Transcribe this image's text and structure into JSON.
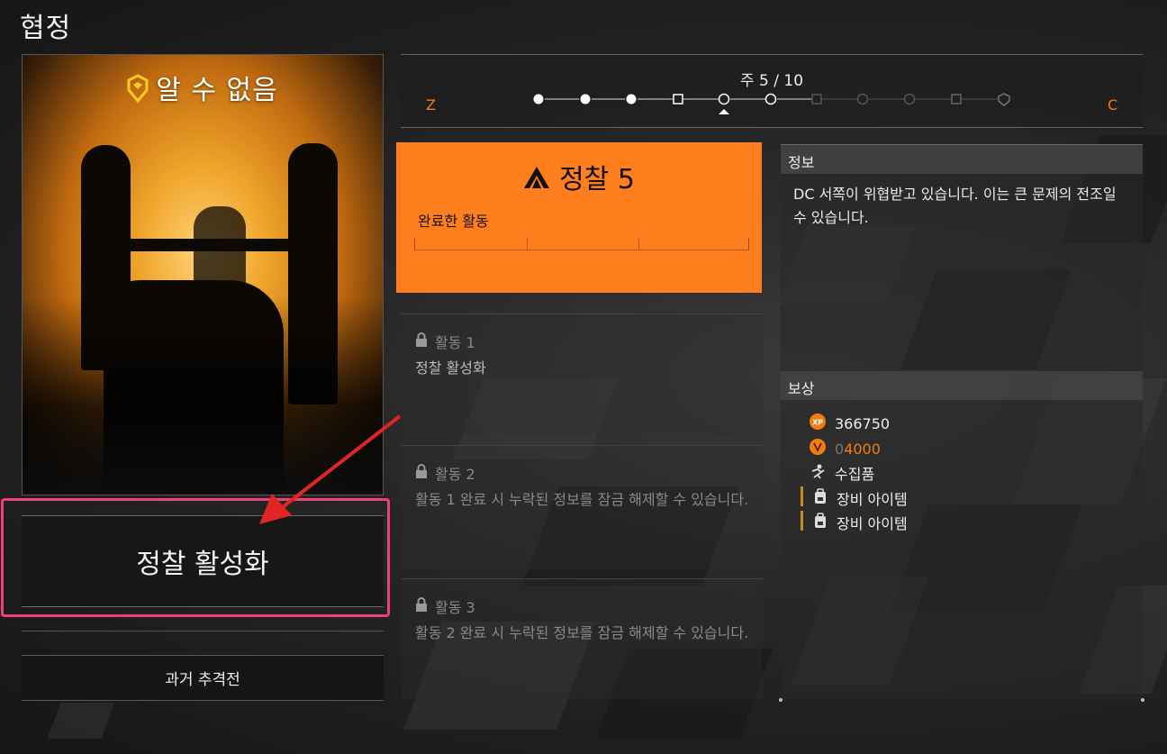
{
  "screen": {
    "title": "협정"
  },
  "card": {
    "title": "알 수 없음",
    "activate_label": "정찰 활성화",
    "history_label": "과거 추격전"
  },
  "progress": {
    "week_label": "주 5 / 10",
    "start_letter": "Z",
    "end_letter": "C",
    "current_week": 5,
    "total_weeks": 10,
    "accent": "#f07c12"
  },
  "mission": {
    "title": "정찰 5",
    "completed_label": "완료한 활동",
    "completed_count": 0,
    "total_count": 3,
    "color": "#ff7f1e"
  },
  "activities": [
    {
      "label": "활동 1",
      "desc": "정찰 활성화",
      "icon": "lock-icon"
    },
    {
      "label": "활동 2",
      "desc": "활동 1 완료 시 누락된 정보를 잠금 해제할 수 있습니다.",
      "icon": "lock-icon"
    },
    {
      "label": "활동 3",
      "desc": "활동 2 완료 시 누락된 정보를 잠금 해제할 수 있습니다.",
      "icon": "lock-icon"
    }
  ],
  "info": {
    "header": "정보",
    "text": "DC 서쪽이 위협받고 있습니다. 이는 큰 문제의 전조일 수 있습니다."
  },
  "rewards": {
    "header": "보상",
    "xp_icon_text": "XP",
    "xp": "366750",
    "currency_prefix": "0",
    "currency": "4000",
    "collectible": "수집품",
    "gear1": "장비 아이템",
    "gear2": "장비 아이템"
  }
}
